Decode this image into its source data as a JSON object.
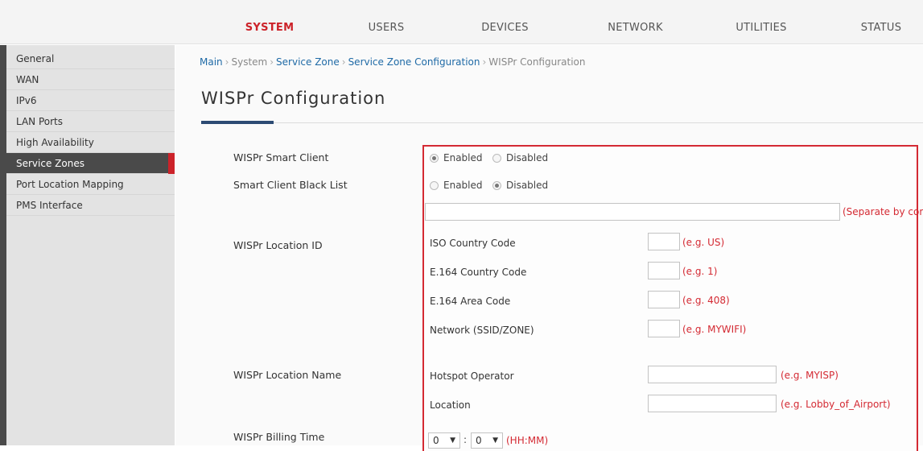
{
  "topnav": {
    "tabs": [
      {
        "label": "SYSTEM",
        "active": true
      },
      {
        "label": "USERS"
      },
      {
        "label": "DEVICES"
      },
      {
        "label": "NETWORK"
      },
      {
        "label": "UTILITIES"
      },
      {
        "label": "STATUS"
      }
    ]
  },
  "sidebar": {
    "items": [
      {
        "label": "General"
      },
      {
        "label": "WAN"
      },
      {
        "label": "IPv6"
      },
      {
        "label": "LAN Ports"
      },
      {
        "label": "High Availability"
      },
      {
        "label": "Service Zones",
        "active": true
      },
      {
        "label": "Port Location Mapping"
      },
      {
        "label": "PMS Interface"
      }
    ]
  },
  "breadcrumb": {
    "main": "Main",
    "system": "System",
    "service_zone": "Service Zone",
    "service_zone_config": "Service Zone Configuration",
    "current": "WISPr Configuration",
    "separator": "›"
  },
  "page": {
    "title": "WISPr Configuration"
  },
  "form": {
    "smart_client": {
      "label": "WISPr Smart Client",
      "enabled": "Enabled",
      "disabled": "Disabled",
      "value": "Enabled"
    },
    "black_list": {
      "label": "Smart Client Black List",
      "enabled": "Enabled",
      "disabled": "Disabled",
      "value": "Disabled",
      "input_value": "",
      "hint": "(Separate by comma)"
    },
    "location_id": {
      "label": "WISPr Location ID",
      "fields": [
        {
          "label": "ISO Country Code",
          "value": "",
          "hint": "(e.g. US)"
        },
        {
          "label": "E.164 Country Code",
          "value": "",
          "hint": "(e.g. 1)"
        },
        {
          "label": "E.164 Area Code",
          "value": "",
          "hint": "(e.g. 408)"
        },
        {
          "label": "Network (SSID/ZONE)",
          "value": "",
          "hint": "(e.g. MYWIFI)"
        }
      ]
    },
    "location_name": {
      "label": "WISPr Location Name",
      "fields": [
        {
          "label": "Hotspot Operator",
          "value": "",
          "hint": "(e.g. MYISP)"
        },
        {
          "label": "Location",
          "value": "",
          "hint": "(e.g. Lobby_of_Airport)"
        }
      ]
    },
    "billing_time": {
      "label": "WISPr Billing Time",
      "hours": "0",
      "minutes": "0",
      "colon": ":",
      "hint": "(HH:MM)",
      "arrow": "▼"
    }
  },
  "colors": {
    "accent": "#cc2229",
    "link": "#1f6aa6",
    "sidebar_dark": "#4a4a4a",
    "title_rule": "#2c4a73"
  }
}
